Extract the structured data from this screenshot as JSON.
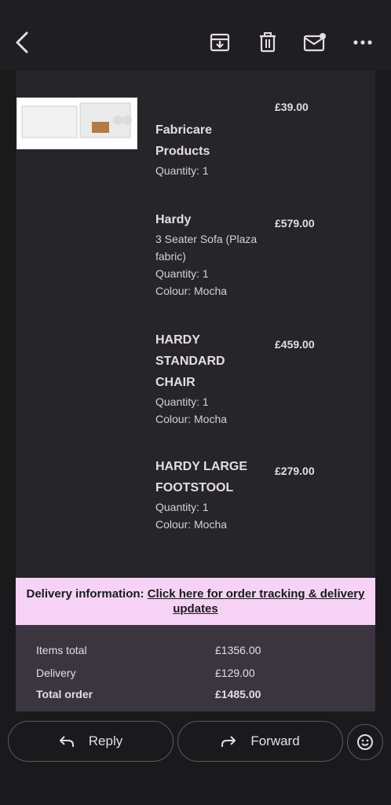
{
  "email": {
    "items": [
      {
        "name": "Fabricare Products",
        "details": [
          "Quantity: 1"
        ],
        "price": "£39.00"
      },
      {
        "name": "Hardy",
        "details": [
          "3 Seater Sofa (Plaza fabric)",
          "Quantity: 1",
          "Colour: Mocha"
        ],
        "price": "£579.00"
      },
      {
        "name": "HARDY STANDARD CHAIR",
        "details": [
          "Quantity: 1",
          "Colour: Mocha"
        ],
        "price": "£459.00"
      },
      {
        "name": "HARDY LARGE FOOTSTOOL",
        "details": [
          "Quantity: 1",
          "Colour: Mocha"
        ],
        "price": "£279.00"
      }
    ],
    "delivery": {
      "label": "Delivery information:",
      "link": "Click here for order tracking & delivery updates"
    },
    "totals": {
      "items_total_label": "Items total",
      "items_total": "£1356.00",
      "delivery_label": "Delivery",
      "delivery": "£129.00",
      "total_order_label": "Total order",
      "total_order": "£1485.00"
    }
  },
  "actions": {
    "reply": "Reply",
    "forward": "Forward"
  },
  "icons": [
    "back-arrow-icon",
    "archive-icon",
    "trash-icon",
    "mark-unread-icon",
    "more-icon",
    "reply-icon",
    "forward-icon",
    "emoji-icon"
  ]
}
